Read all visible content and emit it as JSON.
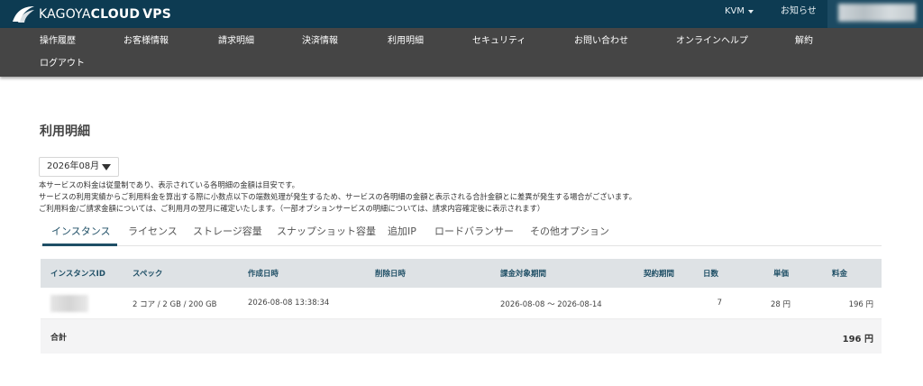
{
  "header": {
    "logo": {
      "brand_light": "KAGOYA",
      "brand_bold": "CLOUD",
      "brand_suffix": "VPS",
      "icon": "kagoya-logo-icon"
    },
    "kvm_label": "KVM",
    "news_label": "お知らせ"
  },
  "nav": {
    "items": [
      {
        "label": "操作履歴"
      },
      {
        "label": "お客様情報"
      },
      {
        "label": "請求明細"
      },
      {
        "label": "決済情報"
      },
      {
        "label": "利用明細"
      },
      {
        "label": "セキュリティ"
      },
      {
        "label": "お問い合わせ"
      },
      {
        "label": "オンラインヘルプ"
      },
      {
        "label": "解約"
      },
      {
        "label": "ログアウト"
      }
    ]
  },
  "page": {
    "title": "利用明細",
    "month_select": {
      "value": "2026年08月"
    },
    "notes": [
      "本サービスの料金は従量制であり、表示されている各明細の金額は目安です。",
      "サービスの利用実績からご利用料金を算出する際に小数点以下の端数処理が発生するため、サービスの各明細の金額と表示される合計金額とに差異が発生する場合がございます。",
      "ご利用料金/ご請求金額については、ご利用月の翌月に確定いたします。（一部オプションサービスの明細については、請求内容確定後に表示されます）"
    ]
  },
  "tabs": [
    {
      "label": "インスタンス",
      "active": true
    },
    {
      "label": "ライセンス"
    },
    {
      "label": "ストレージ容量"
    },
    {
      "label": "スナップショット容量"
    },
    {
      "label": "追加IP"
    },
    {
      "label": "ロードバランサー"
    },
    {
      "label": "その他オプション"
    }
  ],
  "table": {
    "headers": {
      "instance_id": "インスタンスID",
      "spec": "スペック",
      "created": "作成日時",
      "deleted": "削除日時",
      "billing_period": "課金対象期間",
      "contract_period": "契約期間",
      "days": "日数",
      "unit_price": "単価",
      "fee": "料金"
    },
    "rows": [
      {
        "instance_id": "",
        "spec": "2 コア / 2 GB / 200 GB",
        "created": "2026-08-08 13:38:34",
        "deleted": "",
        "billing_period": "2026-08-08 ～ 2026-08-14",
        "contract_period": "",
        "days": "7",
        "unit_price": "28 円",
        "fee": "196 円"
      }
    ],
    "footer": {
      "label": "合計",
      "total": "196 円"
    }
  },
  "colors": {
    "topbar": "#0d3b52",
    "nav": "#454545",
    "accent": "#1f4f66",
    "header_row": "#dee2e5"
  }
}
